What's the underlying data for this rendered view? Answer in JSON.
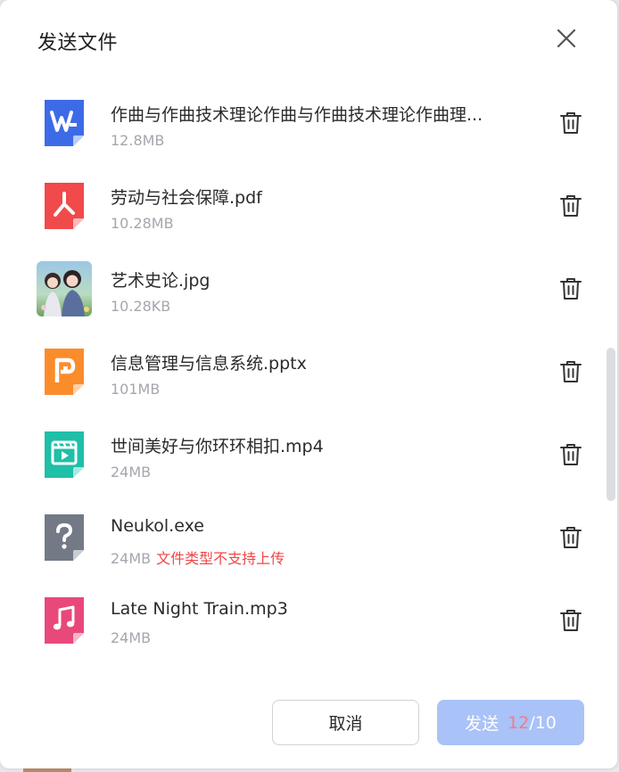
{
  "dialog": {
    "title": "发送文件",
    "close_icon": "close-icon"
  },
  "files": [
    {
      "name": "作曲与作曲技术理论作曲与作曲技术理论作曲理...",
      "size": "12.8MB",
      "icon": "word-doc-icon",
      "color": "#3d6be8"
    },
    {
      "name": "劳动与社会保障.pdf",
      "size": "10.28MB",
      "icon": "pdf-file-icon",
      "color": "#f04a4a"
    },
    {
      "name": "艺术史论.jpg",
      "size": "10.28KB",
      "icon": "image-thumbnail",
      "color": "#7aa6c8"
    },
    {
      "name": "信息管理与信息系统.pptx",
      "size": "101MB",
      "icon": "ppt-file-icon",
      "color": "#fb8c2b"
    },
    {
      "name": "世间美好与你环环相扣.mp4",
      "size": "24MB",
      "icon": "video-file-icon",
      "color": "#1fbfa8"
    },
    {
      "name": "Neukol.exe",
      "size": "24MB",
      "error": "文件类型不支持上传",
      "icon": "unknown-file-icon",
      "color": "#737a86"
    },
    {
      "name": "Late Night Train.mp3",
      "size": "24MB",
      "icon": "audio-file-icon",
      "color": "#e8487a"
    }
  ],
  "footer": {
    "cancel_label": "取消",
    "send_label": "发送",
    "send_count": "12",
    "send_total": "/10"
  },
  "colors": {
    "primary_disabled": "#a9c2f8",
    "error": "#f04545",
    "count_over": "#f37a86"
  }
}
